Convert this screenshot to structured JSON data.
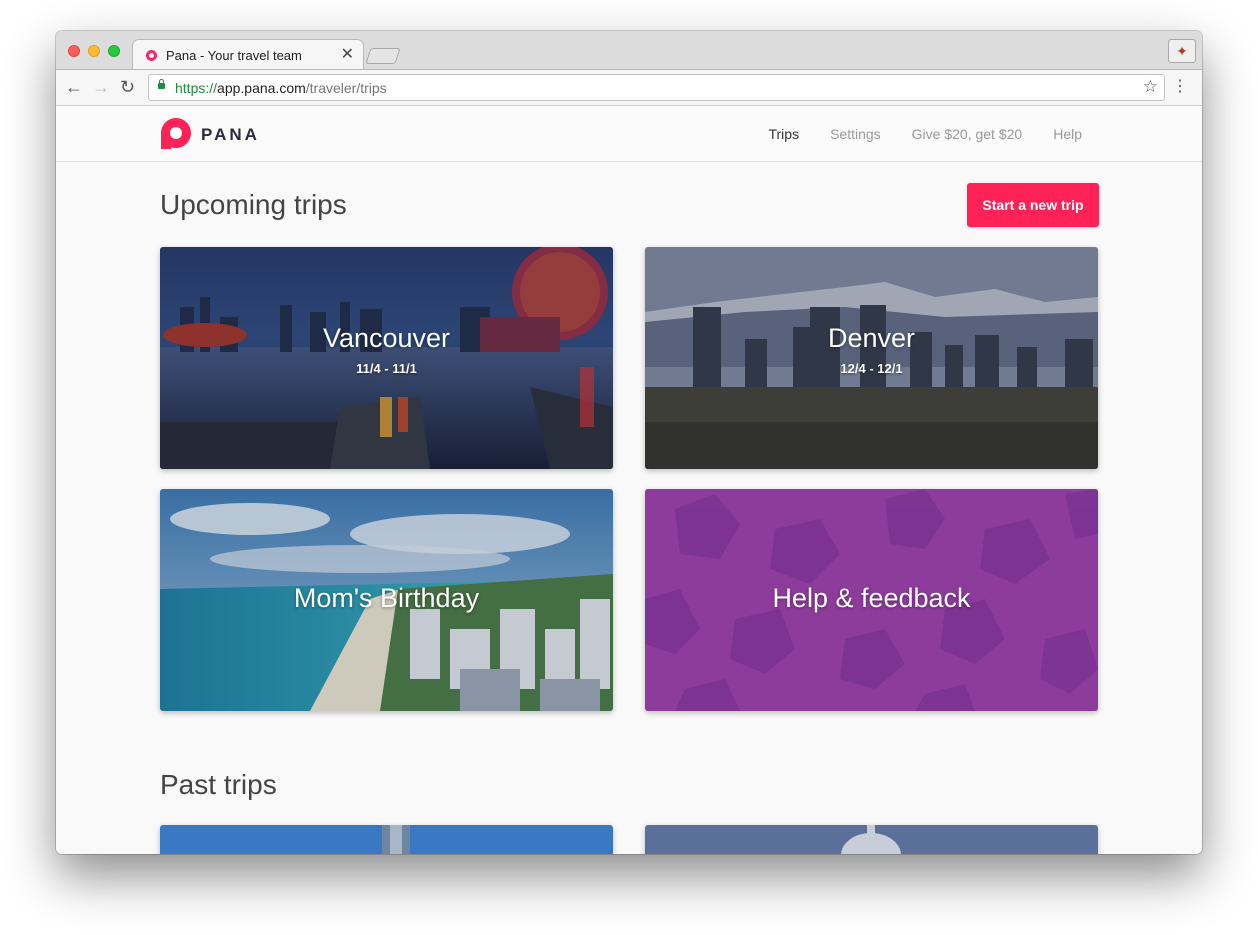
{
  "browser": {
    "tab_title": "Pana - Your travel team",
    "url_scheme": "https://",
    "url_host": "app.pana.com",
    "url_path": "/traveler/trips"
  },
  "header": {
    "logo_text": "PANA",
    "nav": [
      {
        "label": "Trips",
        "active": true
      },
      {
        "label": "Settings",
        "active": false
      },
      {
        "label": "Give $20, get $20",
        "active": false
      },
      {
        "label": "Help",
        "active": false
      }
    ]
  },
  "upcoming": {
    "title": "Upcoming trips",
    "new_trip_label": "Start a new trip",
    "cards": [
      {
        "title": "Vancouver",
        "dates": "11/4 - 11/1"
      },
      {
        "title": "Denver",
        "dates": "12/4 - 12/1"
      },
      {
        "title": "Mom's Birthday",
        "dates": ""
      },
      {
        "title": "Help & feedback",
        "dates": ""
      }
    ]
  },
  "past": {
    "title": "Past trips"
  },
  "colors": {
    "brand": "#ff2257",
    "help_card": "#8e3c9c"
  }
}
